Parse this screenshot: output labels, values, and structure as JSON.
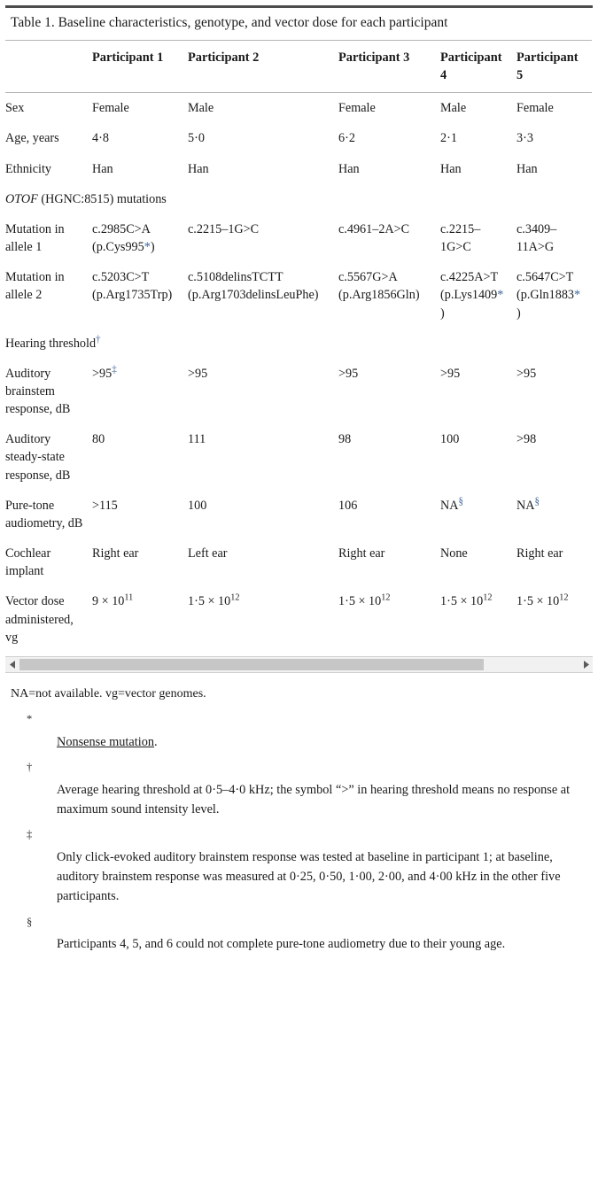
{
  "caption": "Table 1. Baseline characteristics, genotype, and vector dose for each participant",
  "columns": [
    {
      "key": "label",
      "header": ""
    },
    {
      "key": "p1",
      "header": "Participant 1"
    },
    {
      "key": "p2",
      "header": "Participant 2"
    },
    {
      "key": "p3",
      "header": "Participant 3"
    },
    {
      "key": "p4",
      "header": "Participant 4"
    },
    {
      "key": "p5",
      "header": "Participant 5"
    }
  ],
  "rows": {
    "sex": {
      "label": "Sex",
      "p1": "Female",
      "p2": "Male",
      "p3": "Female",
      "p4": "Male",
      "p5": "Female"
    },
    "age": {
      "label": "Age, years",
      "p1": "4·8",
      "p2": "5·0",
      "p3": "6·2",
      "p4": "2·1",
      "p5": "3·3"
    },
    "ethnicity": {
      "label": "Ethnicity",
      "p1": "Han",
      "p2": "Han",
      "p3": "Han",
      "p4": "Han",
      "p5": "Han"
    },
    "otof_section": {
      "gene": "OTOF",
      "rest": " (HGNC:8515) mutations"
    },
    "allele1": {
      "label": "Mutation in allele 1",
      "p1_line1": "c.2985C>A",
      "p1_line2_open": "(p.Cys995",
      "p1_line2_close": ")",
      "p2": "c.2215–1G>C",
      "p3": "c.4961–2A>C",
      "p4": "c.2215–1G>C",
      "p5": "c.3409–11A>G"
    },
    "allele2": {
      "label": "Mutation in allele 2",
      "p1_line1": "c.5203C>T",
      "p1_line2": "(p.Arg1735Trp)",
      "p2_line1": "c.5108delinsTCTT",
      "p2_line2": "(p.Arg1703delinsLeuPhe)",
      "p3_line1": "c.5567G>A",
      "p3_line2": "(p.Arg1856Gln)",
      "p4_line1": "c.4225A>T",
      "p4_line2_open": "(p.Lys1409",
      "p4_line2_close": ")",
      "p5_line1": "c.5647C>T",
      "p5_line2_open": "(p.Gln1883",
      "p5_line2_close": ")"
    },
    "hearing_section": {
      "label": "Hearing threshold"
    },
    "abr": {
      "label": "Auditory brainstem response, dB",
      "p1": ">95",
      "p2": ">95",
      "p3": ">95",
      "p4": ">95",
      "p5": ">95"
    },
    "assr": {
      "label": "Auditory steady-state response, dB",
      "p1": "80",
      "p2": "111",
      "p3": "98",
      "p4": "100",
      "p5": ">98"
    },
    "pta": {
      "label": "Pure-tone audiometry, dB",
      "p1": ">115",
      "p2": "100",
      "p3": "106",
      "p4": "NA",
      "p5": "NA"
    },
    "implant": {
      "label": "Cochlear implant",
      "p1": "Right ear",
      "p2": "Left ear",
      "p3": "Right ear",
      "p4": "None",
      "p5": "Right ear"
    },
    "dose": {
      "label": "Vector dose administered, vg",
      "p1_mantissa": "9 × 10",
      "p1_exp": "11",
      "p2_mantissa": "1·5 × 10",
      "p2_exp": "12",
      "p3_mantissa": "1·5 × 10",
      "p3_exp": "12",
      "p4_mantissa": "1·5 × 10",
      "p4_exp": "12",
      "p5_mantissa": "1·5 × 10",
      "p5_exp": "12"
    }
  },
  "markers": {
    "asterisk": "*",
    "dagger": "†",
    "double_dagger": "‡",
    "section": "§"
  },
  "notes": {
    "abbreviations": "NA=not available. vg=vector genomes.",
    "footnotes": [
      {
        "symbol": "*",
        "linked_text": "Nonsense mutation",
        "trailing": "."
      },
      {
        "symbol": "†",
        "text": "Average hearing threshold at 0·5–4·0 kHz; the symbol “>” in hearing threshold means no response at maximum sound intensity level."
      },
      {
        "symbol": "‡",
        "text": "Only click-evoked auditory brainstem response was tested at baseline in participant 1; at baseline, auditory brainstem response was measured at 0·25, 0·50, 1·00, 2·00, and 4·00 kHz in the other five participants."
      },
      {
        "symbol": "§",
        "text": "Participants 4, 5, and 6 could not complete pure-tone audiometry due to their young age."
      }
    ]
  },
  "scrollbar": {
    "left_arrow_icon": "triangle-left-icon",
    "right_arrow_icon": "triangle-right-icon"
  },
  "colors": {
    "footnote_link": "#41699b",
    "rule_dark": "#4d4d4d",
    "rule_light": "#b5b5b5"
  }
}
